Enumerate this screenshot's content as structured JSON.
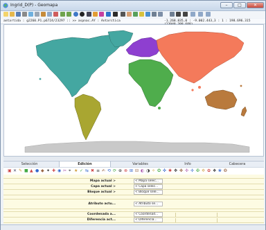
{
  "window": {
    "title": "Ingrid_D(P) - Geomapa"
  },
  "statusline": {
    "left": "antartida : g2260.P1.p6724/23297 ::  >>  aspnac.AY : Antarctica",
    "right": "-1.268.835,0 : -9.002.443,3  :  1 : 198.696.315 (23948.388.608)"
  },
  "tabs": [
    "Selección",
    "Edición",
    "Variables",
    "Info",
    "Cabecera"
  ],
  "active_tab": "Edición",
  "panel": {
    "rows": [
      {
        "label": "Mapa actual >",
        "value": "< Mapa selec..."
      },
      {
        "label": "Capa actual >",
        "value": "< Capa selec..."
      },
      {
        "label": "Bloque actual >",
        "value": "< Bloque sele..."
      },
      {
        "label": "Atributo actu...",
        "value": "< Atributo se..."
      },
      {
        "label": "Coordenada a...",
        "value": "< Coordenad..."
      },
      {
        "label": "Diferencia act...",
        "value": "< Diferencia..."
      }
    ]
  },
  "colors": {
    "north_america": "#44a7a1",
    "south_america": "#a9a631",
    "europe": "#8e3fd0",
    "africa": "#4fad4c",
    "asia": "#f47a5b",
    "oceania": "#b97a3d",
    "antarctica": "#c9c9c9"
  }
}
